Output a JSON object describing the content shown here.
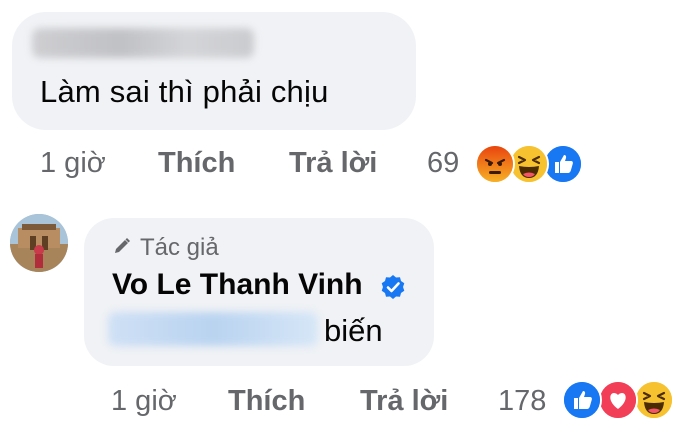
{
  "comment1": {
    "author_redacted": true,
    "text": "Làm sai thì phải chịu",
    "time": "1 giờ",
    "like_label": "Thích",
    "reply_label": "Trả lời",
    "reaction_count": "69",
    "reactions": [
      "angry",
      "haha",
      "like"
    ]
  },
  "comment2": {
    "author_badge": "Tác giả",
    "author_name": "Vo Le Thanh Vinh",
    "verified": true,
    "text_suffix": "biến",
    "time": "1 giờ",
    "like_label": "Thích",
    "reply_label": "Trả lời",
    "reaction_count": "178",
    "reactions": [
      "like",
      "love",
      "haha"
    ]
  },
  "colors": {
    "bubble": "#f0f2f5",
    "meta_text": "#65676b",
    "like_blue": "#1877f2",
    "love_red": "#f33e58",
    "haha_yellow": "#f7b125",
    "angry_orange": "#e9710f",
    "verified_blue": "#1877f2"
  }
}
